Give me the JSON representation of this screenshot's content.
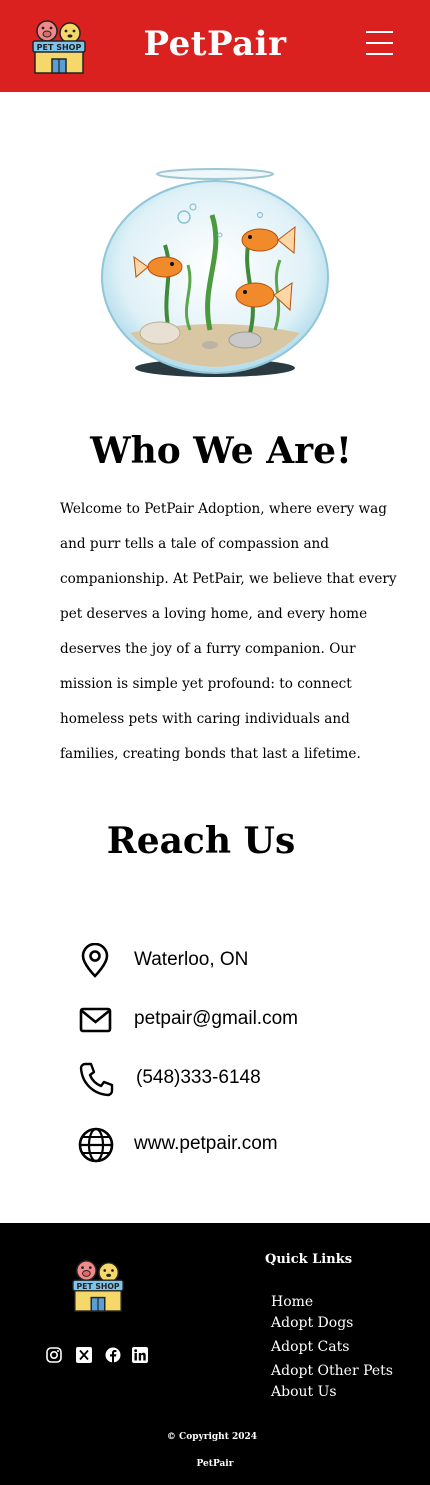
{
  "header": {
    "brand": "PetPair",
    "logo_text": "PET SHOP",
    "background_color": "#db2020",
    "menu_icon": "hamburger-menu-icon"
  },
  "about": {
    "image": "fishbowl-illustration",
    "title": "Who We Are!",
    "body": "Welcome to PetPair Adoption, where every wag and purr tells a tale of compassion and companionship. At PetPair, we believe that every pet deserves a loving home, and every home deserves the joy of a furry companion. Our mission is simple yet profound: to connect homeless pets with caring individuals and families, creating bonds that last a lifetime."
  },
  "contact": {
    "title": "Reach Us",
    "items": [
      {
        "icon": "location-pin-icon",
        "text": "Waterloo, ON"
      },
      {
        "icon": "mail-icon",
        "text": "petpair@gmail.com"
      },
      {
        "icon": "phone-icon",
        "text": "(548)333-6148"
      },
      {
        "icon": "globe-icon",
        "text": "www.petpair.com"
      }
    ]
  },
  "footer": {
    "logo_text": "PET SHOP",
    "socials": [
      "instagram-icon",
      "x-twitter-icon",
      "facebook-icon",
      "linkedin-icon"
    ],
    "quick_links_title": "Quick Links",
    "quick_links": [
      "Home",
      "Adopt Dogs",
      "Adopt Cats",
      "Adopt Other Pets",
      "About Us"
    ],
    "copyright": "© Copyright 2024",
    "copyright_brand": "PetPair"
  }
}
